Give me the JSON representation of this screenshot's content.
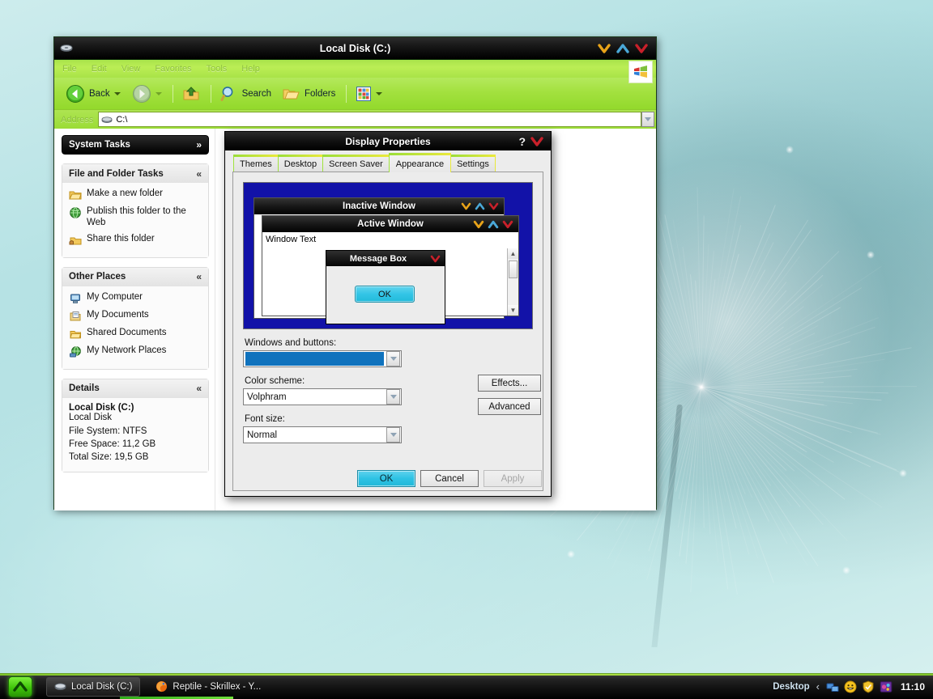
{
  "desktop": {
    "wallpaper_description": "dandelion seed head, teal background"
  },
  "explorer": {
    "title": "Local Disk (C:)",
    "titlebar_icon": "disk-drive-icon",
    "window_buttons": [
      {
        "name": "minimize",
        "glyph": "∨",
        "color": "#e8a319"
      },
      {
        "name": "maximize",
        "glyph": "∧",
        "color": "#4aa8d8"
      },
      {
        "name": "close",
        "glyph": "∨",
        "color": "#c8202a"
      }
    ],
    "menus": [
      "File",
      "Edit",
      "View",
      "Favorites",
      "Tools",
      "Help"
    ],
    "toolbar": {
      "back_label": "Back",
      "search_label": "Search",
      "folders_label": "Folders"
    },
    "address": {
      "label": "Address",
      "value": "C:\\",
      "placeholder": "Address"
    },
    "sidebar": {
      "panels": [
        {
          "title": "System Tasks",
          "collapsed": true,
          "chevron": "»",
          "items": []
        },
        {
          "title": "File and Folder Tasks",
          "collapsed": false,
          "chevron": "«",
          "items": [
            {
              "label": "Make a new folder",
              "icon": "new-folder-icon"
            },
            {
              "label": "Publish this folder to the Web",
              "icon": "globe-icon"
            },
            {
              "label": "Share this folder",
              "icon": "share-folder-icon"
            }
          ]
        },
        {
          "title": "Other Places",
          "collapsed": false,
          "chevron": "«",
          "items": [
            {
              "label": "My Computer",
              "icon": "my-computer-icon"
            },
            {
              "label": "My Documents",
              "icon": "my-documents-icon"
            },
            {
              "label": "Shared Documents",
              "icon": "shared-documents-icon"
            },
            {
              "label": "My Network Places",
              "icon": "network-places-icon"
            }
          ]
        }
      ],
      "details": {
        "title": "Details",
        "chevron": "«",
        "name": "Local Disk (C:)",
        "type": "Local Disk",
        "lines": [
          "File System: NTFS",
          "Free Space: 11,2 GB",
          "Total Size: 19,5 GB"
        ]
      }
    }
  },
  "dialog": {
    "title": "Display Properties",
    "help_glyph": "?",
    "close_glyph": "∨",
    "tabs": [
      {
        "label": "Themes",
        "active": false
      },
      {
        "label": "Desktop",
        "active": false
      },
      {
        "label": "Screen Saver",
        "active": false
      },
      {
        "label": "Appearance",
        "active": true
      },
      {
        "label": "Settings",
        "active": false
      }
    ],
    "preview": {
      "background_color": "#1212a8",
      "inactive_window_title": "Inactive Window",
      "active_window_title": "Active Window",
      "window_text": "Window Text",
      "message_box_title": "Message Box",
      "message_box_ok": "OK",
      "button_accent": "#2ec2e4"
    },
    "fields": [
      {
        "label": "Windows and buttons:",
        "value": "",
        "selected": true
      },
      {
        "label": "Color scheme:",
        "value": "Volphram",
        "selected": false
      },
      {
        "label": "Font size:",
        "value": "Normal",
        "selected": false
      }
    ],
    "side_buttons": [
      {
        "label": "Effects...",
        "enabled": true
      },
      {
        "label": "Advanced",
        "enabled": true
      }
    ],
    "footer_buttons": [
      {
        "label": "OK",
        "style": "primary",
        "enabled": true
      },
      {
        "label": "Cancel",
        "style": "normal",
        "enabled": true
      },
      {
        "label": "Apply",
        "style": "disabled",
        "enabled": false
      }
    ]
  },
  "taskbar": {
    "start_glyph": "∧",
    "tasks": [
      {
        "label": "Local Disk (C:)",
        "icon": "disk-drive-icon",
        "active": true
      },
      {
        "label": "Reptile - Skrillex - Y...",
        "icon": "firefox-icon",
        "active": false
      }
    ],
    "tray": {
      "desktop_label": "Desktop",
      "expand_glyph": "‹",
      "icons": [
        "network-icon",
        "smiley-icon",
        "shield-icon",
        "media-player-icon"
      ],
      "clock": "11:10"
    }
  }
}
